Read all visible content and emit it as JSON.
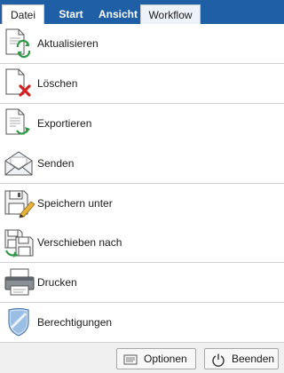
{
  "ribbon": {
    "tabs": [
      {
        "label": "Datei",
        "state": "active"
      },
      {
        "label": "Start",
        "state": "normal"
      },
      {
        "label": "Ansicht",
        "state": "normal"
      },
      {
        "label": "Workflow",
        "state": "highlighted"
      }
    ]
  },
  "menu": {
    "items": [
      {
        "label": "Aktualisieren",
        "icon": "document-refresh-icon"
      },
      {
        "label": "Löschen",
        "icon": "document-delete-icon"
      },
      {
        "label": "Exportieren",
        "icon": "document-export-icon"
      },
      {
        "label": "Senden",
        "icon": "envelope-icon"
      },
      {
        "label": "Speichern unter",
        "icon": "save-as-icon"
      },
      {
        "label": "Verschieben nach",
        "icon": "move-to-icon"
      },
      {
        "label": "Drucken",
        "icon": "printer-icon"
      },
      {
        "label": "Berechtigungen",
        "icon": "shield-icon"
      }
    ]
  },
  "footer": {
    "options_label": "Optionen",
    "exit_label": "Beenden"
  },
  "colors": {
    "ribbon": "#1f5fa5",
    "accent_green": "#2f9a46",
    "accent_red": "#d32020",
    "shield": "#7da6d6"
  }
}
